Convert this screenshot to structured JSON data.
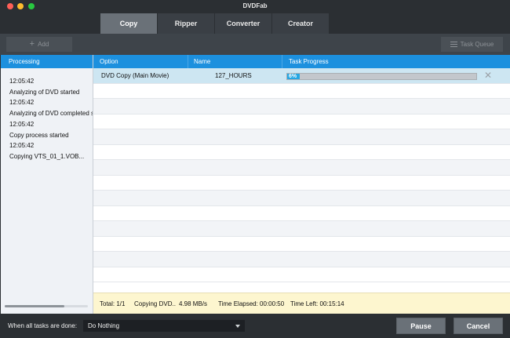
{
  "window": {
    "title": "DVDFab"
  },
  "tabs": [
    {
      "label": "Copy",
      "active": true
    },
    {
      "label": "Ripper",
      "active": false
    },
    {
      "label": "Converter",
      "active": false
    },
    {
      "label": "Creator",
      "active": false
    }
  ],
  "toolbar": {
    "add_label": "Add",
    "add_icon": "plus-icon",
    "queue_label": "Task Queue",
    "queue_icon": "list-icon"
  },
  "left_panel": {
    "header": "Processing",
    "log": [
      "12:05:42",
      "Analyzing of DVD started",
      "12:05:42",
      "Analyzing of DVD completed s",
      "12:05:42",
      "Copy process started",
      "12:05:42",
      "Copying VTS_01_1.VOB..."
    ]
  },
  "table": {
    "columns": [
      "Option",
      "Name",
      "Task Progress"
    ],
    "rows": [
      {
        "option": "DVD Copy (Main Movie)",
        "name": "127_HOURS",
        "progress_text": "6%",
        "progress": 0.06
      }
    ]
  },
  "status": {
    "total": "Total: 1/1",
    "action": "Copying DVD..",
    "speed": "4.98 MB/s",
    "elapsed": "Time Elapsed: 00:00:50",
    "left": "Time Left: 00:15:14"
  },
  "bottom": {
    "when_label": "When all tasks are done:",
    "select_value": "Do Nothing",
    "pause_label": "Pause",
    "cancel_label": "Cancel"
  },
  "colors": {
    "accent": "#1c90de",
    "progress": "#26a7e3",
    "selected_row": "#cde6f2",
    "status_bg": "#fdf6cf"
  }
}
